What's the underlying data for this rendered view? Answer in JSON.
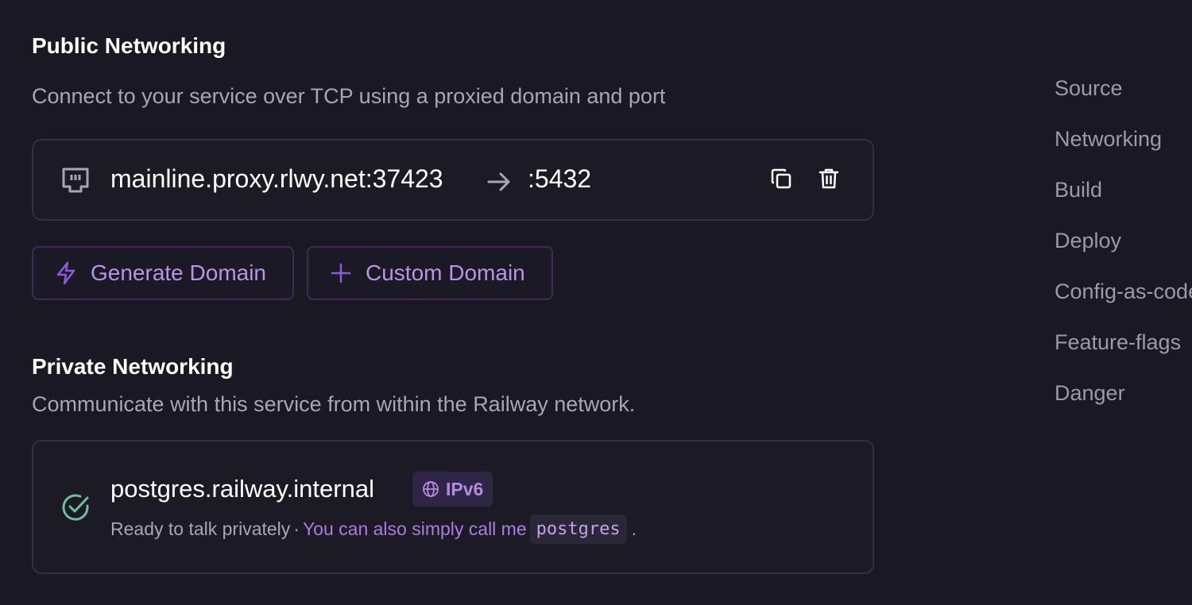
{
  "public": {
    "title": "Public Networking",
    "description": "Connect to your service over TCP using a proxied domain and port",
    "proxy": {
      "domain": "mainline.proxy.rlwy.net:37423",
      "port": ":5432",
      "icons": [
        "ethernet-port-icon",
        "arrow-right-icon",
        "copy-icon",
        "trash-icon"
      ]
    },
    "buttons": {
      "generate_label": "Generate Domain",
      "custom_label": "Custom Domain",
      "generate_icon": "lightning-icon",
      "custom_icon": "plus-icon"
    }
  },
  "private": {
    "title": "Private Networking",
    "description": "Communicate with this service from within the Railway network.",
    "domain": "postgres.railway.internal",
    "badge": "IPv6",
    "status_text": "Ready to talk privately",
    "separator": "·",
    "link_text": "You can also simply call me",
    "alias": "postgres",
    "period": "."
  },
  "nav": {
    "items": [
      {
        "label": "Source"
      },
      {
        "label": "Networking"
      },
      {
        "label": "Build"
      },
      {
        "label": "Deploy"
      },
      {
        "label": "Config-as-code"
      },
      {
        "label": "Feature-flags"
      },
      {
        "label": "Danger"
      }
    ]
  },
  "colors": {
    "background": "#1a1823",
    "accent": "#b895e3",
    "success": "#6fbf95",
    "muted": "#a9a6b4"
  }
}
